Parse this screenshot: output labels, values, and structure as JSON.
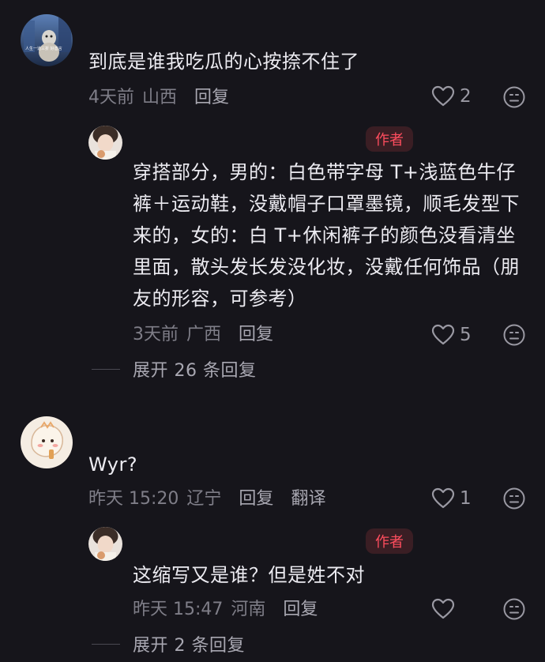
{
  "comments": [
    {
      "text": "到底是谁我吃瓜的心按捺不住了",
      "avatar_caption": "人生一道三折 好善言",
      "time": "4天前",
      "location": "山西",
      "reply_label": "回复",
      "likes": "2",
      "replies": [
        {
          "badge": "作者",
          "text": "穿搭部分，男的：白色带字母 T+浅蓝色牛仔裤＋运动鞋，没戴帽子口罩墨镜，顺毛发型下来的，女的：白 T+休闲裤子的颜色没看清坐里面，散头发长发没化妆，没戴任何饰品（朋友的形容，可参考）",
          "time": "3天前",
          "location": "广西",
          "reply_label": "回复",
          "likes": "5"
        }
      ],
      "expand_label": "展开 26 条回复"
    },
    {
      "text": "Wyr?",
      "time": "昨天 15:20",
      "location": "辽宁",
      "reply_label": "回复",
      "translate_label": "翻译",
      "likes": "1",
      "replies": [
        {
          "badge": "作者",
          "text": "这缩写又是谁？但是姓不对",
          "time": "昨天 15:47",
          "location": "河南",
          "reply_label": "回复",
          "likes": ""
        }
      ],
      "expand_label": "展开 2 条回复"
    }
  ],
  "colors": {
    "background": "#16151b",
    "badge_bg": "#3a1e24",
    "badge_text": "#ff4d5e",
    "meta_text": "#7f7e88"
  }
}
